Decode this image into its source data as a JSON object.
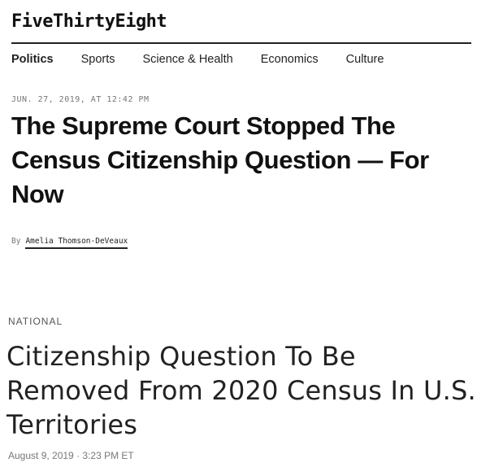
{
  "site": {
    "logo": "FiveThirtyEight"
  },
  "nav": {
    "items": [
      {
        "label": "Politics",
        "active": true
      },
      {
        "label": "Sports",
        "active": false
      },
      {
        "label": "Science & Health",
        "active": false
      },
      {
        "label": "Economics",
        "active": false
      },
      {
        "label": "Culture",
        "active": false
      }
    ]
  },
  "article1": {
    "dateline": "JUN. 27, 2019, AT 12:42 PM",
    "headline": "The Supreme Court Stopped The Census Citizenship Question — For Now",
    "byline_prefix": "By",
    "author": "Amelia Thomson-DeVeaux"
  },
  "article2": {
    "section": "NATIONAL",
    "headline": "Citizenship Question To Be Removed From 2020 Census In U.S. Territories",
    "date": "August 9, 2019 · 3:23 PM ET"
  }
}
